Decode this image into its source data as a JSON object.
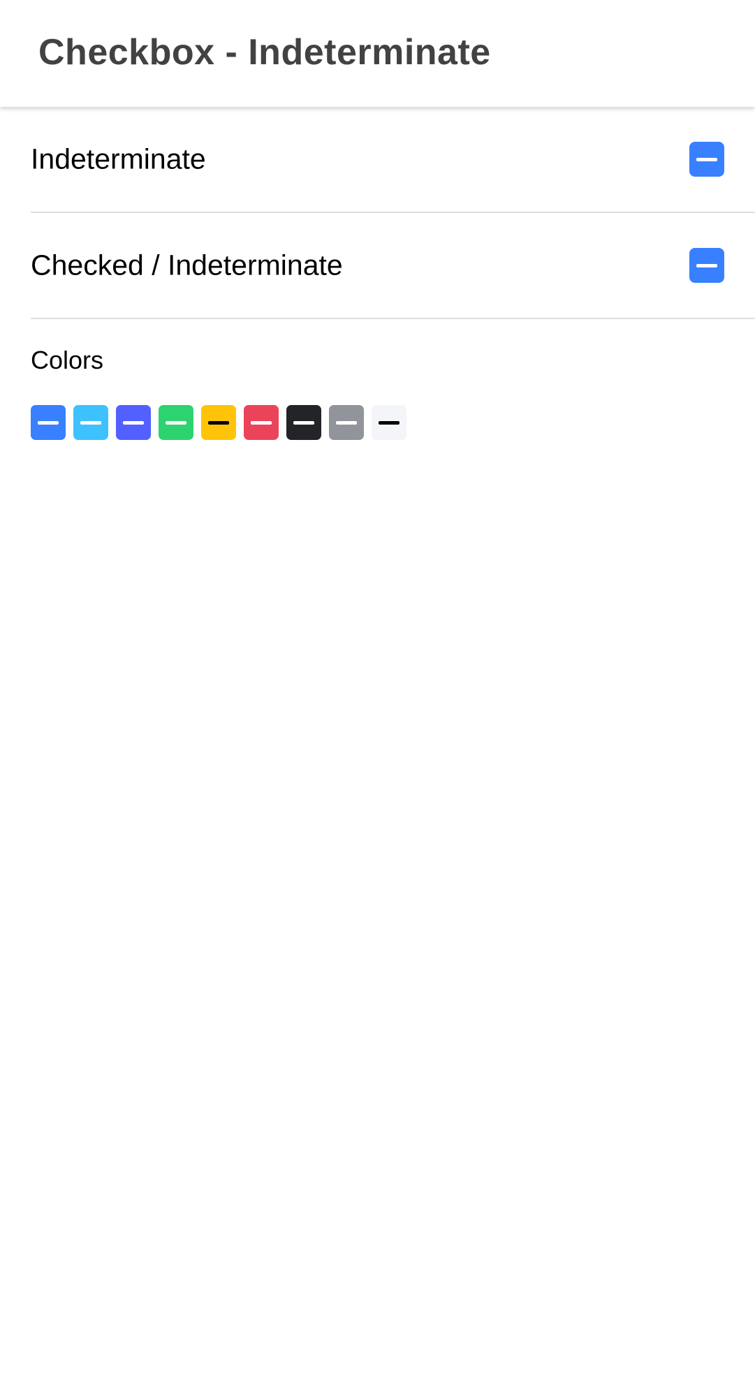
{
  "toolbar": {
    "title": "Checkbox - Indeterminate"
  },
  "items": [
    {
      "label": "Indeterminate",
      "state": "indeterminate",
      "color": "#3880ff",
      "mark_color": "#ffffff"
    },
    {
      "label": "Checked / Indeterminate",
      "state": "indeterminate",
      "color": "#3880ff",
      "mark_color": "#ffffff"
    }
  ],
  "colors_section": {
    "label": "Colors",
    "checkboxes": [
      {
        "name": "primary",
        "state": "indeterminate",
        "color": "#3880ff",
        "mark_color": "#ffffff"
      },
      {
        "name": "secondary",
        "state": "indeterminate",
        "color": "#3dc2ff",
        "mark_color": "#ffffff"
      },
      {
        "name": "tertiary",
        "state": "indeterminate",
        "color": "#5260ff",
        "mark_color": "#ffffff"
      },
      {
        "name": "success",
        "state": "indeterminate",
        "color": "#2dd36f",
        "mark_color": "#ffffff"
      },
      {
        "name": "warning",
        "state": "indeterminate",
        "color": "#ffc409",
        "mark_color": "#000000"
      },
      {
        "name": "danger",
        "state": "indeterminate",
        "color": "#eb445a",
        "mark_color": "#ffffff"
      },
      {
        "name": "dark",
        "state": "indeterminate",
        "color": "#222428",
        "mark_color": "#ffffff"
      },
      {
        "name": "medium",
        "state": "indeterminate",
        "color": "#92949c",
        "mark_color": "#ffffff"
      },
      {
        "name": "light",
        "state": "indeterminate",
        "color": "#f4f5f8",
        "mark_color": "#000000"
      }
    ]
  }
}
